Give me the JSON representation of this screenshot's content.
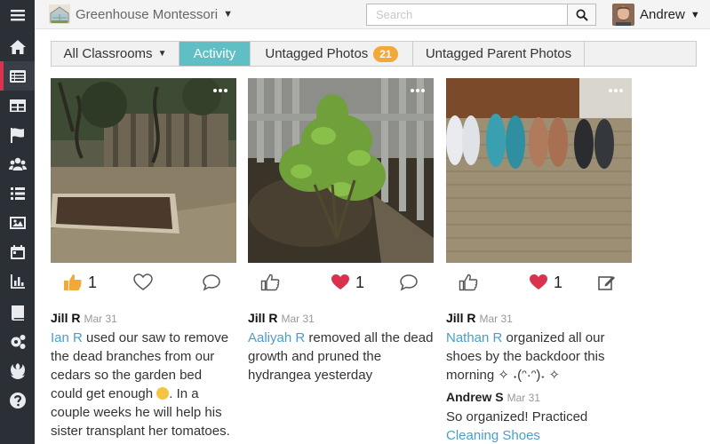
{
  "header": {
    "school_name": "Greenhouse Montessori",
    "search_placeholder": "Search",
    "user_name": "Andrew"
  },
  "sidebar": {
    "items": [
      {
        "icon": "menu-icon"
      },
      {
        "icon": "home-icon"
      },
      {
        "icon": "activity-feed-icon",
        "active": true
      },
      {
        "icon": "table-icon"
      },
      {
        "icon": "flag-icon"
      },
      {
        "icon": "users-icon"
      },
      {
        "icon": "list-icon"
      },
      {
        "icon": "image-icon"
      },
      {
        "icon": "calendar-icon"
      },
      {
        "icon": "chart-icon"
      },
      {
        "icon": "book-icon"
      },
      {
        "icon": "settings-icon"
      },
      {
        "icon": "rebel-icon"
      },
      {
        "icon": "help-icon"
      }
    ]
  },
  "tabs": [
    {
      "label": "All Classrooms"
    },
    {
      "label": "Activity",
      "active": true
    },
    {
      "label": "Untagged Photos",
      "badge": "21"
    },
    {
      "label": "Untagged Parent Photos"
    }
  ],
  "posts": [
    {
      "likes": "1",
      "liked": true,
      "author": "Jill R",
      "date": "Mar 31",
      "tagged_child": "Ian R",
      "text_1": " used our saw to remove the dead branches from our cedars so the garden bed could get enough ",
      "text_2": ". In a couple weeks he will help his sister transplant her tomatoes."
    },
    {
      "hearts": "1",
      "author": "Jill R",
      "date": "Mar 31",
      "tagged_child": "Aaliyah R",
      "text_1": " removed all the dead growth and pruned the hydrangea yesterday"
    },
    {
      "hearts": "1",
      "author": "Jill R",
      "date": "Mar 31",
      "tagged_child": "Nathan R",
      "text_1": " organized all our shoes by the backdoor this morning ✧ ˖(ᵔ·ᵔ)˖ ✧",
      "comment": {
        "author": "Andrew S",
        "date": "Mar 31",
        "text": "So organized! Practiced ",
        "link": "Cleaning Shoes"
      }
    }
  ],
  "colors": {
    "sidebar_bg": "#2b2f36",
    "active_marker": "#d8324e",
    "active_tab": "#5fbfc4",
    "badge": "#f3a93a",
    "link": "#4a9ec9",
    "heart": "#d8324e",
    "like": "#f3a93a"
  }
}
